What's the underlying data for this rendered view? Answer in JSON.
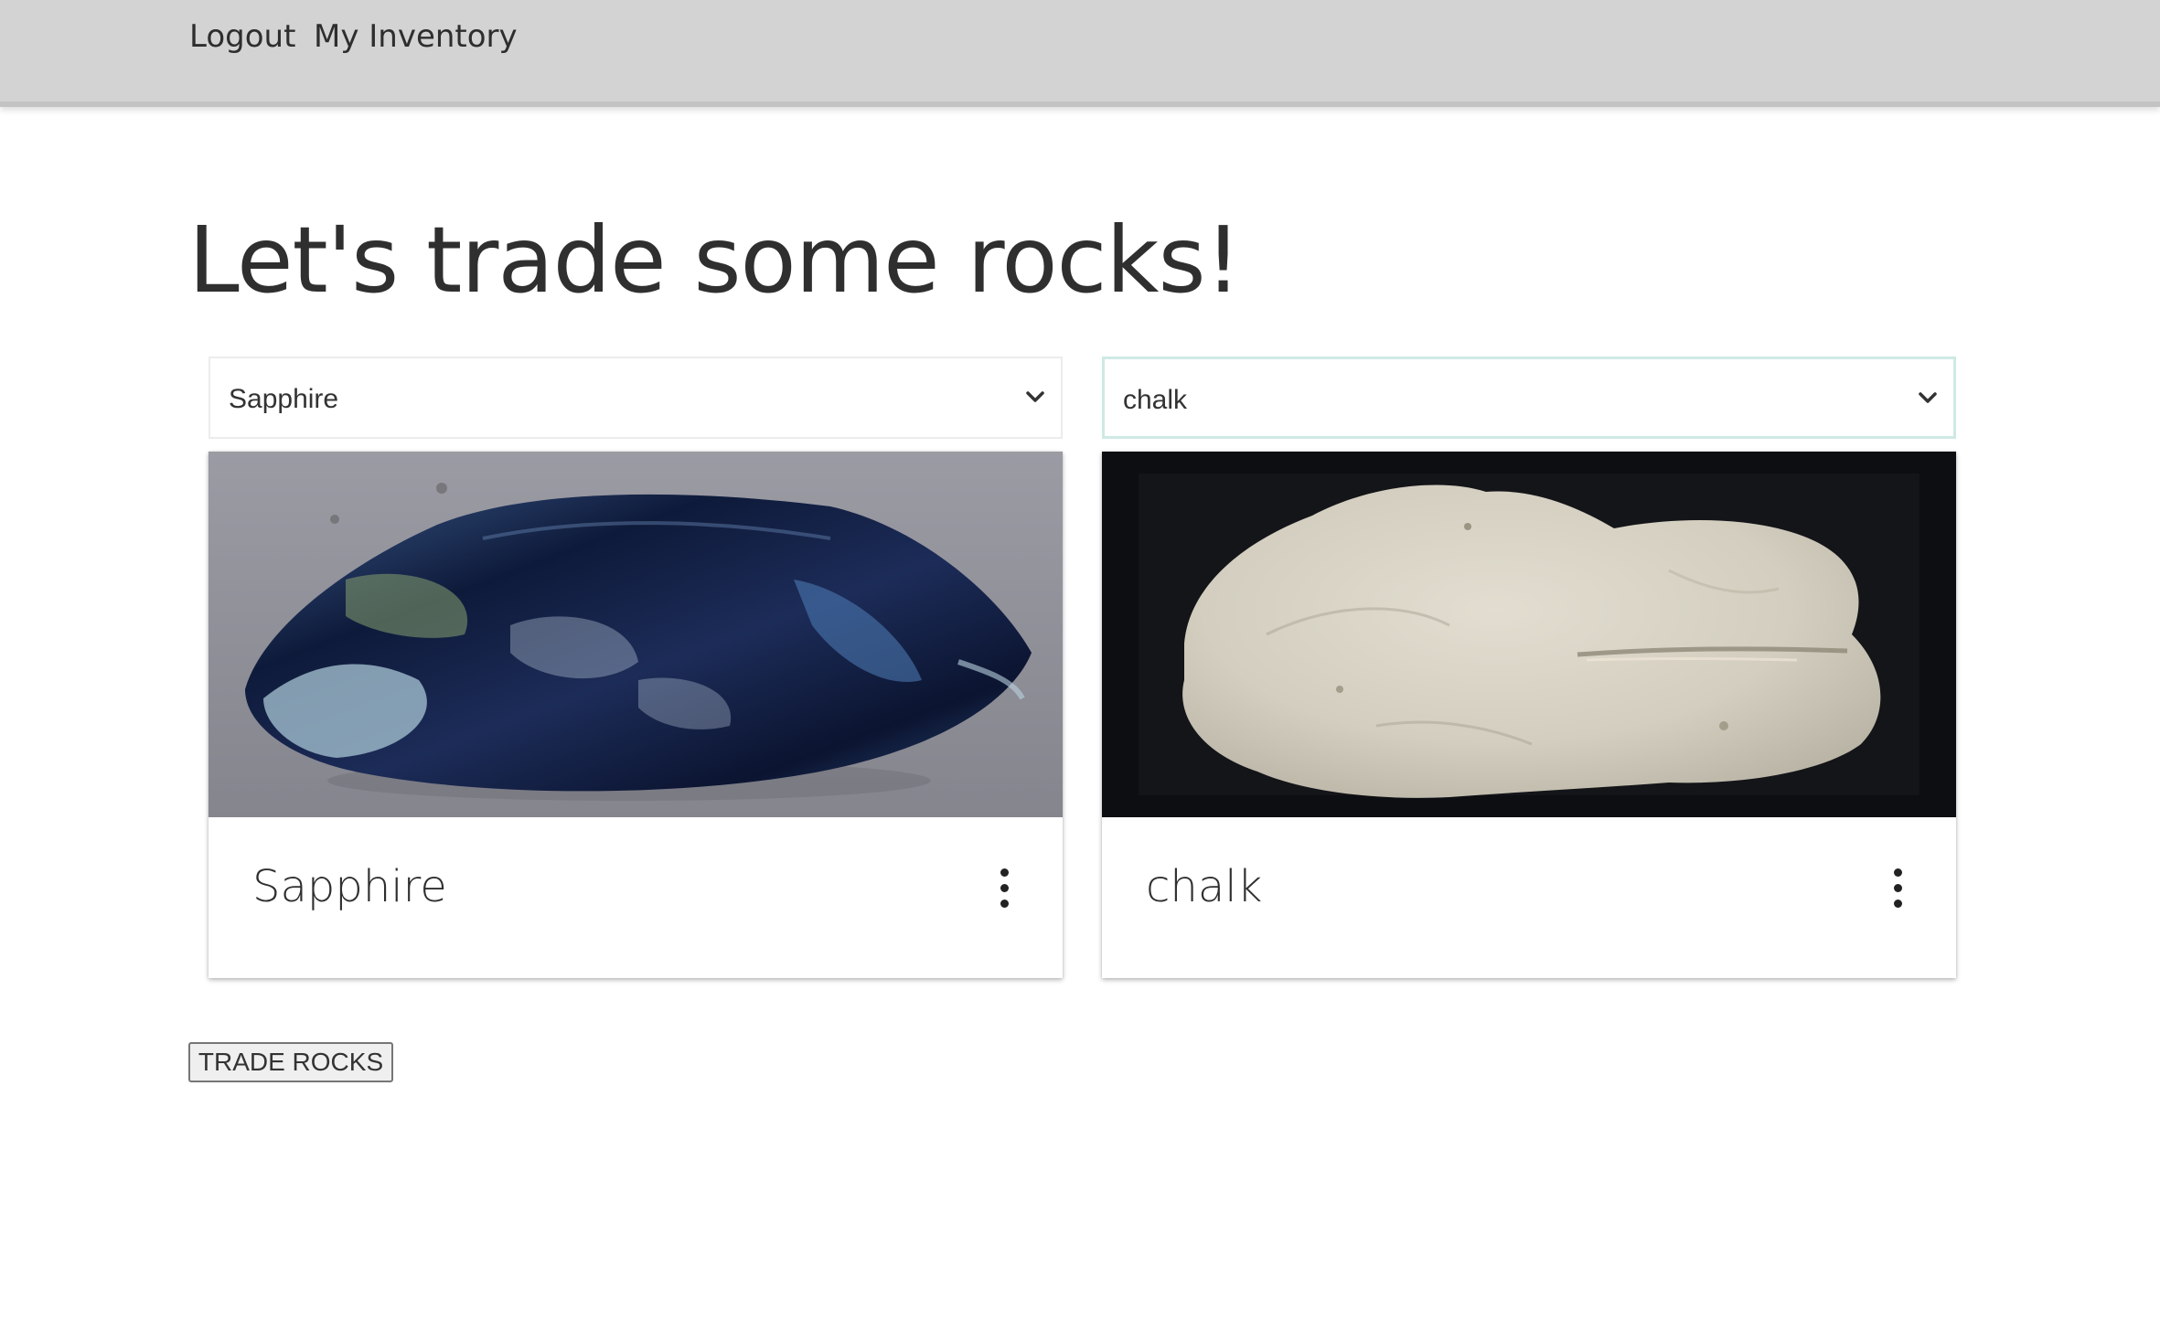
{
  "nav": {
    "logout_label": "Logout",
    "inventory_label": "My Inventory"
  },
  "page": {
    "title": "Let's trade some rocks!"
  },
  "left": {
    "select_value": "Sapphire",
    "card_title": "Sapphire",
    "image_icon": "sapphire-rock-photo"
  },
  "right": {
    "select_value": "chalk",
    "card_title": "chalk",
    "image_icon": "chalk-rock-photo"
  },
  "actions": {
    "trade_label": "TRADE ROCKS"
  },
  "colors": {
    "navbar_bg": "#d3d3d3",
    "focus_border": "#cfe9e4",
    "sapphire_bg": "#8f8f98",
    "chalk_bg": "#0d0e12"
  },
  "icons": {
    "chevron": "chevron-down-icon",
    "menu": "more-vert-icon"
  }
}
